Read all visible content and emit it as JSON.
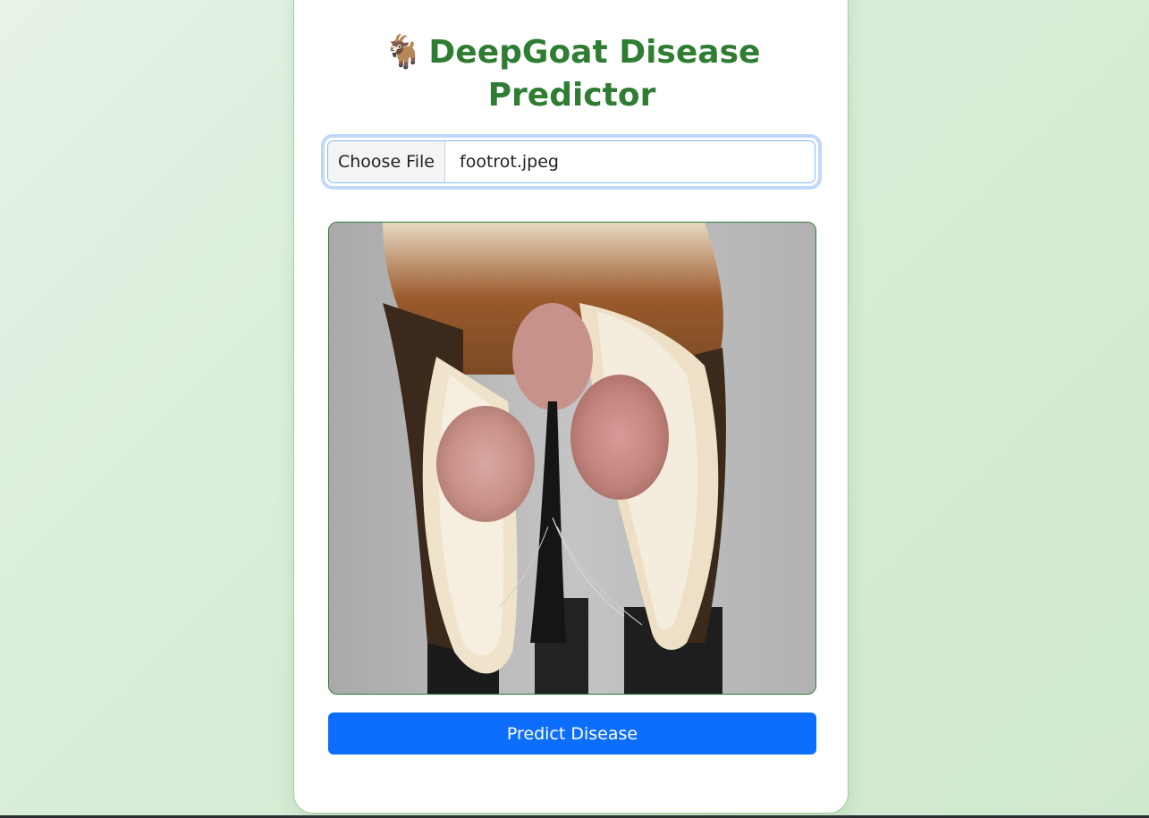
{
  "header": {
    "emoji": "🐐",
    "title": "DeepGoat Disease Predictor"
  },
  "upload": {
    "button_label": "Choose File",
    "file_name": "footrot.jpeg"
  },
  "preview": {
    "image_subject": "goat hoof with foot rot"
  },
  "actions": {
    "predict_label": "Predict Disease"
  },
  "colors": {
    "title": "#2e7d32",
    "primary": "#0d6efd",
    "focus_ring": "#c2d8fb"
  }
}
